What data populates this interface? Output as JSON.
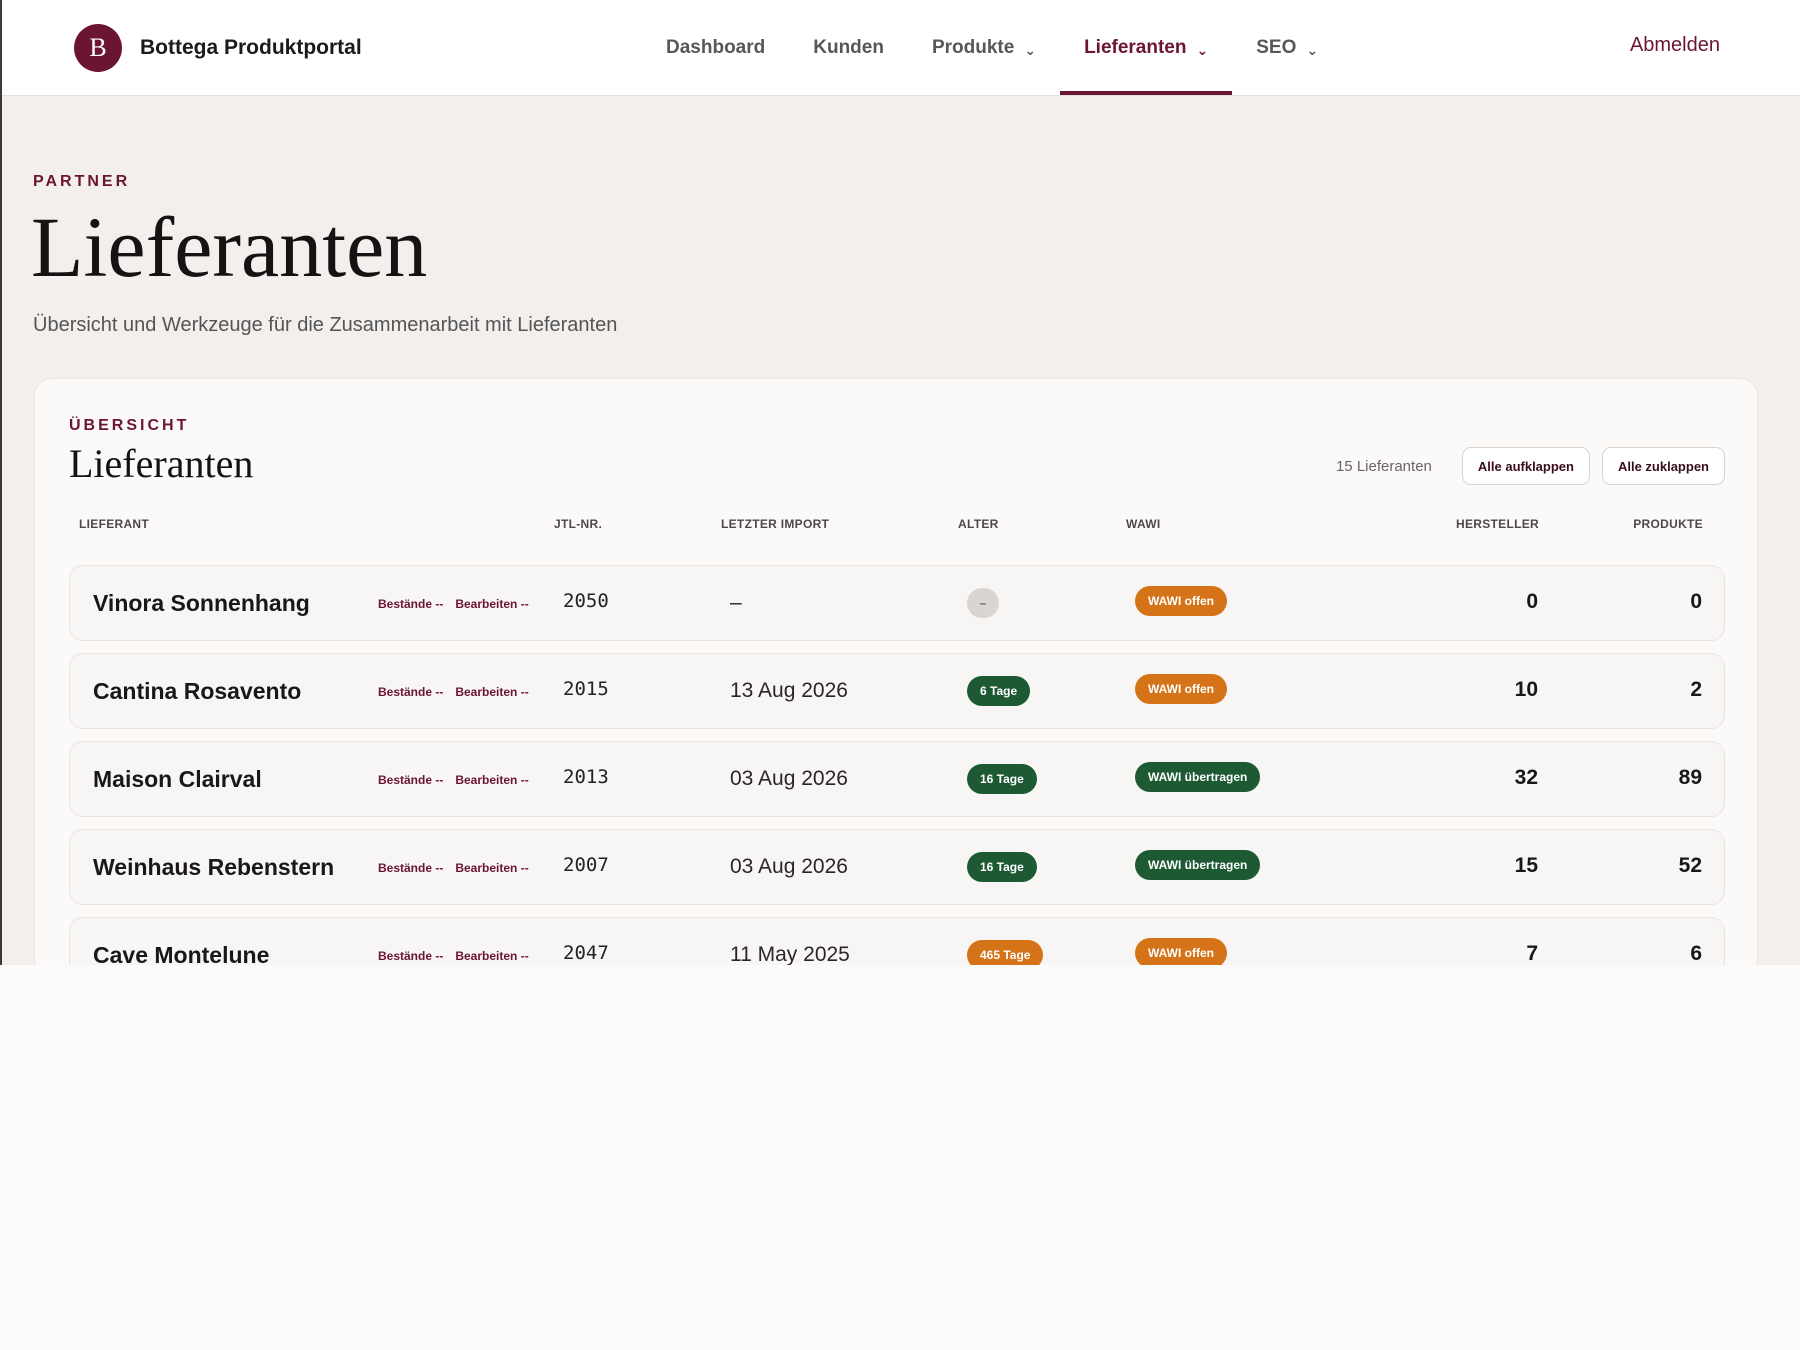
{
  "brand": {
    "logo_letter": "B",
    "name": "Bottega Produktportal"
  },
  "nav": [
    {
      "label": "Dashboard",
      "has_menu": false,
      "active": false
    },
    {
      "label": "Kunden",
      "has_menu": false,
      "active": false
    },
    {
      "label": "Produkte",
      "has_menu": true,
      "active": false
    },
    {
      "label": "Lieferanten",
      "has_menu": true,
      "active": true
    },
    {
      "label": "SEO",
      "has_menu": true,
      "active": false
    }
  ],
  "chevron_glyph": "⌄",
  "logout_label": "Abmelden",
  "page": {
    "eyebrow": "PARTNER",
    "title": "Lieferanten",
    "subtitle": "Übersicht und Werkzeuge für die Zusammenarbeit mit Lieferanten"
  },
  "card": {
    "eyebrow": "ÜBERSICHT",
    "title": "Lieferanten",
    "count_label": "15 Lieferanten",
    "expand_all_label": "Alle aufklappen",
    "collapse_all_label": "Alle zuklappen"
  },
  "table": {
    "columns": [
      "LIEFERANT",
      "JTL-NR.",
      "LETZTER IMPORT",
      "ALTER",
      "WAWI",
      "HERSTELLER",
      "PRODUKTE"
    ],
    "action_links": [
      "Bestände --",
      "Bearbeiten --"
    ],
    "rows": [
      {
        "name": "Vinora Sonnenhang",
        "jtl": "2050",
        "last_import": "–",
        "age": "–",
        "age_status": "none",
        "wawi": "WAWI offen",
        "wawi_status": "open",
        "hersteller": "0",
        "produkte": "0"
      },
      {
        "name": "Cantina Rosavento",
        "jtl": "2015",
        "last_import": "13 Aug 2026",
        "age": "6 Tage",
        "age_status": "fresh",
        "wawi": "WAWI offen",
        "wawi_status": "open",
        "hersteller": "10",
        "produkte": "2"
      },
      {
        "name": "Maison Clairval",
        "jtl": "2013",
        "last_import": "03 Aug 2026",
        "age": "16 Tage",
        "age_status": "fresh",
        "wawi": "WAWI übertragen",
        "wawi_status": "transferred",
        "hersteller": "32",
        "produkte": "89"
      },
      {
        "name": "Weinhaus Rebenstern",
        "jtl": "2007",
        "last_import": "03 Aug 2026",
        "age": "16 Tage",
        "age_status": "fresh",
        "wawi": "WAWI übertragen",
        "wawi_status": "transferred",
        "hersteller": "15",
        "produkte": "52"
      },
      {
        "name": "Cave Montelune",
        "jtl": "2047",
        "last_import": "11 May 2025",
        "age": "465 Tage",
        "age_status": "stale",
        "wawi": "WAWI offen",
        "wawi_status": "open",
        "hersteller": "7",
        "produkte": "6"
      }
    ]
  },
  "colors": {
    "accent": "#6b1530",
    "status_green": "#1d5a33",
    "status_orange": "#d47318",
    "status_grey": "#d9d5d2"
  }
}
